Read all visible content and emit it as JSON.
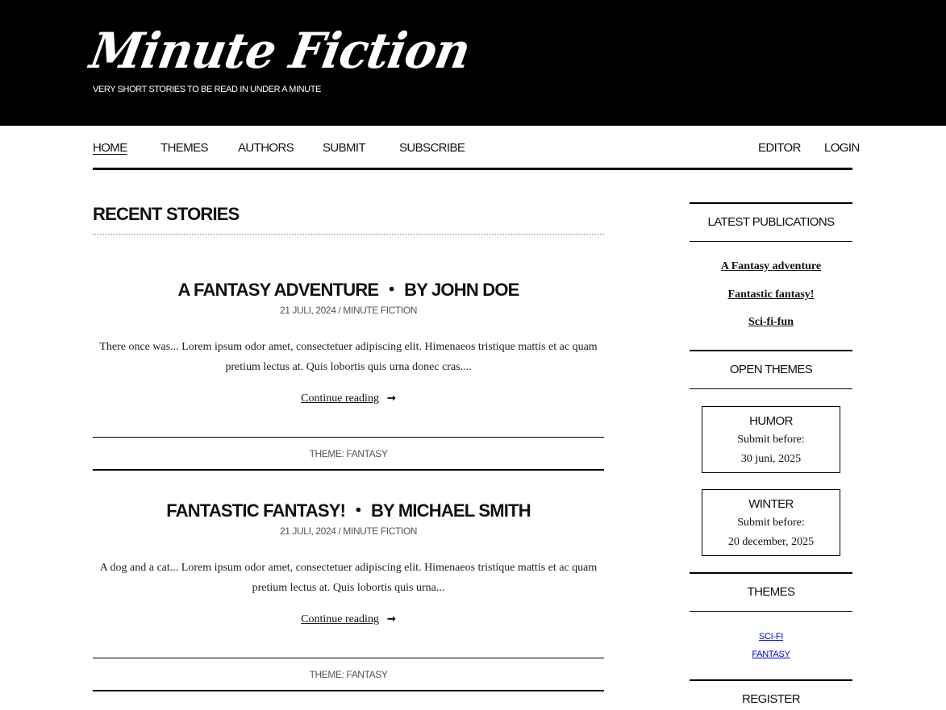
{
  "header": {
    "logo": "Minute Fiction",
    "tagline": "VERY SHORT STORIES TO BE READ IN UNDER A MINUTE"
  },
  "nav": {
    "left": [
      "HOME",
      "THEMES",
      "AUTHORS",
      "SUBMIT",
      "SUBSCRIBE"
    ],
    "right": [
      "EDITOR",
      "LOGIN"
    ],
    "active": "HOME"
  },
  "main": {
    "section_title": "RECENT STORIES",
    "stories": [
      {
        "title": "A FANTASY ADVENTURE",
        "separator": "・",
        "byline": "BY JOHN DOE",
        "date": "21 JULI, 2024",
        "meta_sep": "/",
        "category": "MINUTE FICTION",
        "excerpt": "There once was... Lorem ipsum odor amet, consectetuer adipiscing elit. Himenaeos tristique mattis et ac quam pretium lectus at. Quis lobortis quis urna donec cras....",
        "continue": "Continue reading",
        "theme": "THEME: FANTASY"
      },
      {
        "title": "FANTASTIC FANTASY!",
        "separator": "・",
        "byline": "BY MICHAEL SMITH",
        "date": "21 JULI, 2024",
        "meta_sep": "/",
        "category": "MINUTE FICTION",
        "excerpt": "A dog and a cat... Lorem ipsum odor amet, consectetuer adipiscing elit. Himenaeos tristique mattis et ac quam pretium lectus at. Quis lobortis quis urna...",
        "continue": "Continue reading",
        "theme": "THEME: FANTASY"
      }
    ]
  },
  "sidebar": {
    "latest_title": "LATEST PUBLICATIONS",
    "latest": [
      "A Fantasy adventure",
      "Fantastic fantasy!",
      "Sci-fi-fun"
    ],
    "open_title": "OPEN THEMES",
    "open_themes": [
      {
        "name": "HUMOR",
        "label": "Submit before:",
        "deadline": "30 juni, 2025"
      },
      {
        "name": "WINTER",
        "label": "Submit before:",
        "deadline": "20 december, 2025"
      }
    ],
    "themes_title": "THEMES",
    "themes": [
      "SCI-FI",
      "FANTASY"
    ],
    "register_title": "REGISTER"
  },
  "icons": {
    "continue_arrow": "right-arrow-icon"
  }
}
